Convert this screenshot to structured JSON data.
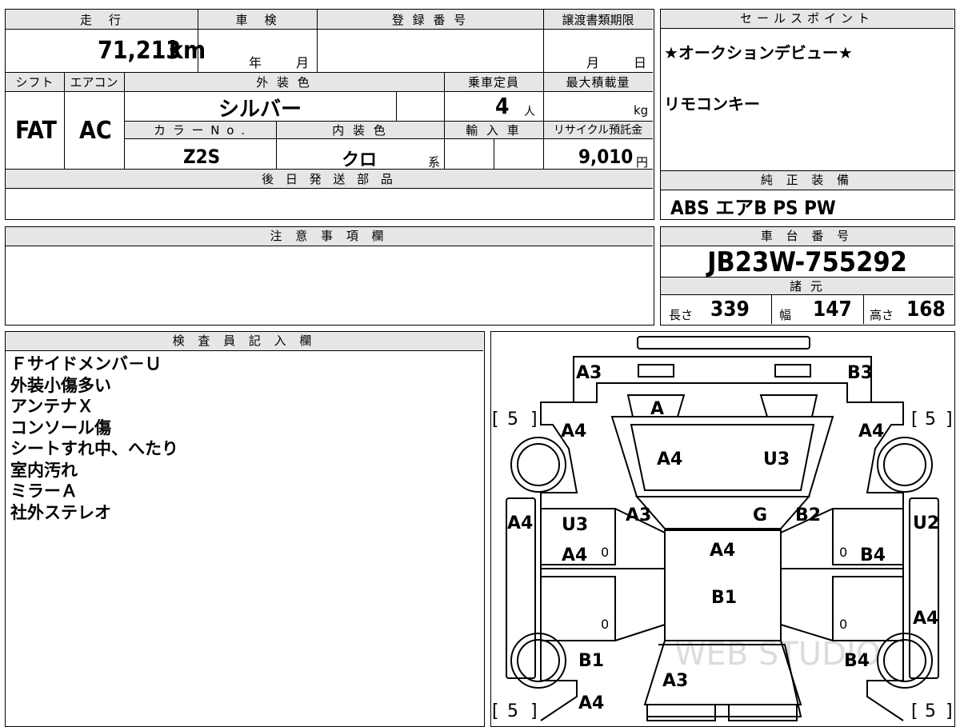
{
  "vehicle": {
    "mileage_label": "走　行",
    "mileage_value": "71,213",
    "mileage_unit": "km",
    "inspection_label": "車　検",
    "inspection_year_unit": "年",
    "inspection_month_unit": "月",
    "registration_label": "登 録 番 号",
    "transfer_deadline_label": "譲渡書類期限",
    "transfer_month_unit": "月",
    "transfer_day_unit": "日",
    "shift_label": "シフト",
    "shift_value": "FAT",
    "aircon_label": "エアコン",
    "aircon_value": "AC",
    "exterior_color_label": "外 装 色",
    "exterior_color_value": "シルバー",
    "capacity_label": "乗車定員",
    "capacity_value": "4",
    "capacity_unit": "人",
    "max_load_label": "最大積載量",
    "max_load_unit": "kg",
    "color_no_label": "カ ラ ー N o .",
    "color_no_value": "Z2S",
    "interior_color_label": "内 装 色",
    "interior_color_value": "クロ",
    "interior_color_suffix": "系",
    "import_label": "輸 入 車",
    "recycle_label": "リサイクル預託金",
    "recycle_value": "9,010",
    "recycle_unit": "円",
    "later_parts_label": "後 日 発 送 部 品"
  },
  "sales_points": {
    "label": "セールスポイント",
    "lines": [
      "★オークションデビュー★",
      "リモコンキー"
    ]
  },
  "equipment": {
    "label": "純 正 装 備",
    "value": "ABS エアB PS PW"
  },
  "caution": {
    "label": "注 意 事 項 欄"
  },
  "chassis": {
    "label": "車 台 番 号",
    "value": "JB23W-755292"
  },
  "specs": {
    "label": "諸 元",
    "length_label": "長さ",
    "length_value": "339",
    "width_label": "幅",
    "width_value": "147",
    "height_label": "高さ",
    "height_value": "168"
  },
  "inspector": {
    "label": "検 査 員 記 入 欄",
    "notes": [
      "Ｆサイドメンバ－Ｕ",
      "外装小傷多い",
      "アンテナＸ",
      "コンソール傷",
      "シートすれ中、へたり",
      "室内汚れ",
      "ミラーＡ",
      "社外ステレオ"
    ]
  },
  "diagram": {
    "tire_tread": [
      "5",
      "5",
      "5",
      "5"
    ],
    "damage_marks": {
      "front_left_corner": "A3",
      "front_right_corner": "B3",
      "grille": "A",
      "front_left_fender": "A4",
      "front_right_fender": "A4",
      "hood_left": "A4",
      "hood_right": "U3",
      "left_a_pillar": "A3",
      "windshield": "G",
      "right_a_pillar": "B2",
      "left_rocker": "A4",
      "left_front_door_upper": "U3",
      "left_front_door_lower": "A4",
      "right_rocker": "U2",
      "right_front_door": "B4",
      "roof_front": "A4",
      "roof_rear": "B1",
      "right_rear_side": "A4",
      "left_rear_fender": "B1",
      "right_rear_fender": "B4",
      "rear_gate": "A3",
      "left_rear_corner": "A4"
    },
    "zeros": [
      "0",
      "0",
      "0",
      "0"
    ],
    "watermark": "WEB STUDIO"
  }
}
